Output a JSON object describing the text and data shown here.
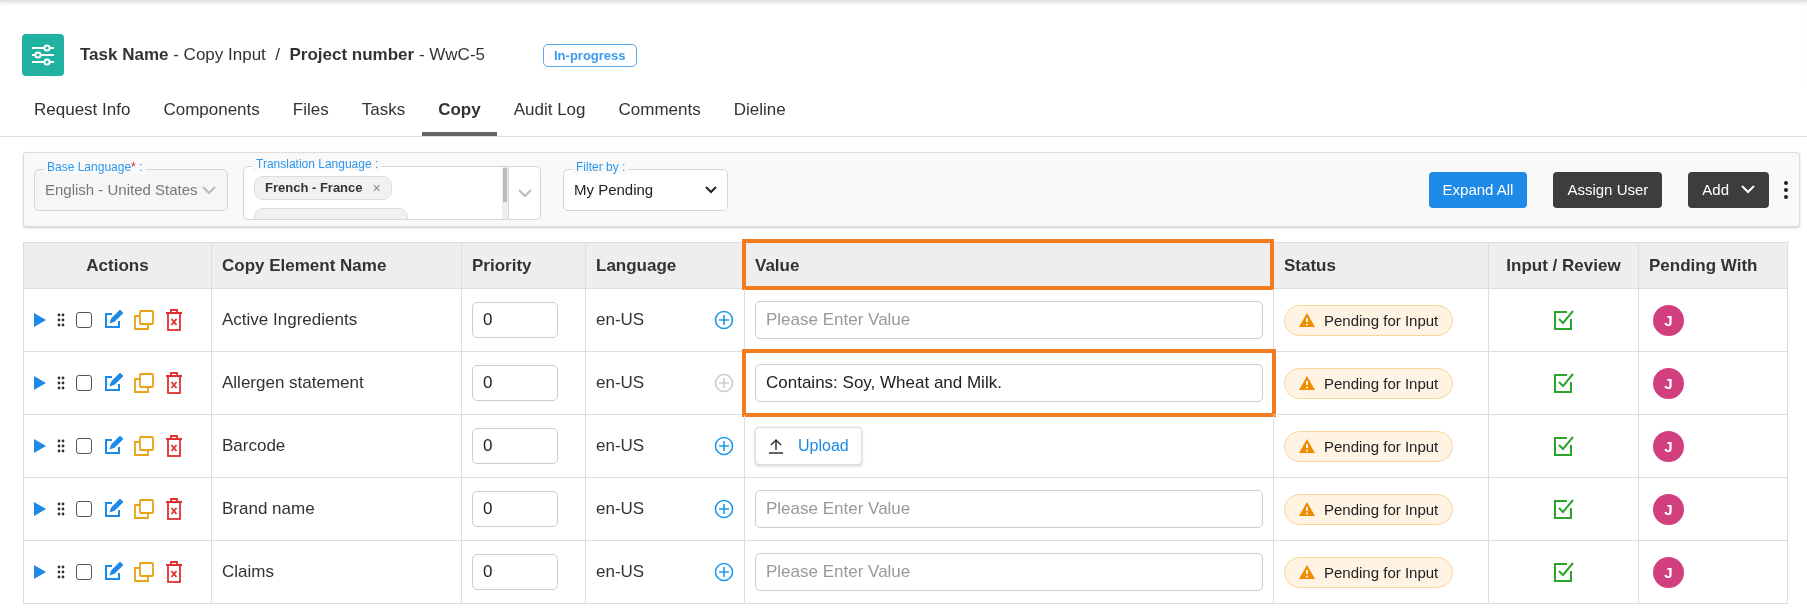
{
  "header": {
    "task_label": "Task Name",
    "task_value": "- Copy Input",
    "separator": "/",
    "project_label": "Project number",
    "project_value": "- WwC-5",
    "status": "In-progress"
  },
  "tabs": [
    {
      "label": "Request Info",
      "selected": false
    },
    {
      "label": "Components",
      "selected": false
    },
    {
      "label": "Files",
      "selected": false
    },
    {
      "label": "Tasks",
      "selected": false
    },
    {
      "label": "Copy",
      "selected": true
    },
    {
      "label": "Audit Log",
      "selected": false
    },
    {
      "label": "Comments",
      "selected": false
    },
    {
      "label": "Dieline",
      "selected": false
    }
  ],
  "toolbar": {
    "base_language": {
      "label": "Base Language",
      "required_mark": "*",
      "label_suffix": ":",
      "value": "English - United States",
      "disabled": true
    },
    "translation_language": {
      "label": "Translation Language :",
      "chips": [
        {
          "label": "French - France",
          "remove": "×"
        }
      ]
    },
    "filter": {
      "label": "Filter by :",
      "value": "My Pending"
    },
    "buttons": [
      {
        "label": "Expand All",
        "kind": "primary"
      },
      {
        "label": "Assign User",
        "kind": "dark"
      },
      {
        "label": "Add",
        "kind": "dropdown"
      }
    ]
  },
  "table": {
    "columns": [
      {
        "label": "Actions",
        "highlighted": false
      },
      {
        "label": "Copy Element Name",
        "highlighted": false
      },
      {
        "label": "Priority",
        "highlighted": false
      },
      {
        "label": "Language",
        "highlighted": false
      },
      {
        "label": "Value",
        "highlighted": true
      },
      {
        "label": "Status",
        "highlighted": false
      },
      {
        "label": "Input / Review",
        "highlighted": false
      },
      {
        "label": "Pending With",
        "highlighted": false
      }
    ],
    "rows": [
      {
        "checked": false,
        "name": "Active Ingredients",
        "priority": "0",
        "language": "en-US",
        "add_enabled": true,
        "kind": "text",
        "placeholder": "Please Enter Value",
        "highlighted": false,
        "status": "Pending for Input",
        "review_checked": true,
        "avatar": "J"
      },
      {
        "checked": false,
        "name": "Allergen statement",
        "priority": "0",
        "language": "en-US",
        "add_enabled": false,
        "kind": "text",
        "value": "Contains: Soy, Wheat and Milk.",
        "highlighted": true,
        "status": "Pending for Input",
        "review_checked": true,
        "avatar": "J"
      },
      {
        "checked": false,
        "name": "Barcode",
        "priority": "0",
        "language": "en-US",
        "add_enabled": true,
        "kind": "upload",
        "upload_label": "Upload",
        "highlighted": false,
        "status": "Pending for Input",
        "review_checked": true,
        "avatar": "J"
      },
      {
        "checked": false,
        "name": "Brand name",
        "priority": "0",
        "language": "en-US",
        "add_enabled": true,
        "kind": "text",
        "placeholder": "Please Enter Value",
        "highlighted": false,
        "status": "Pending for Input",
        "review_checked": true,
        "avatar": "J"
      },
      {
        "checked": false,
        "name": "Claims",
        "priority": "0",
        "language": "en-US",
        "add_enabled": true,
        "kind": "text",
        "placeholder": "Please Enter Value",
        "highlighted": false,
        "status": "Pending for Input",
        "review_checked": true,
        "avatar": "J"
      }
    ]
  }
}
